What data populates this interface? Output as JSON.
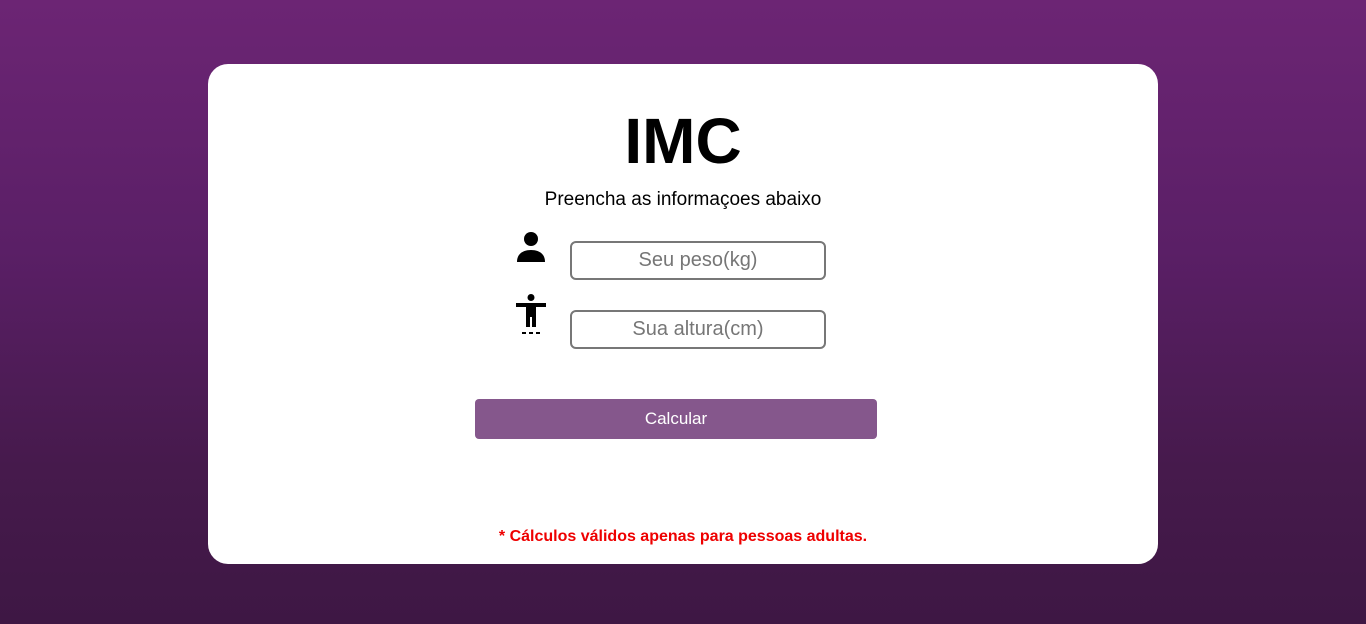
{
  "header": {
    "title": "IMC",
    "subtitle": "Preencha as informaçoes abaixo"
  },
  "form": {
    "weight": {
      "icon": "person-icon",
      "placeholder": "Seu peso(kg)",
      "value": ""
    },
    "height": {
      "icon": "accessibility-body-icon",
      "placeholder": "Sua altura(cm)",
      "value": ""
    },
    "submit_label": "Calcular"
  },
  "footer": {
    "note": "* Cálculos válidos apenas para pessoas adultas."
  },
  "colors": {
    "background_top": "#6c2574",
    "background_bottom": "#3e1744",
    "card": "#ffffff",
    "button": "#85578c",
    "note": "#ee0000"
  }
}
